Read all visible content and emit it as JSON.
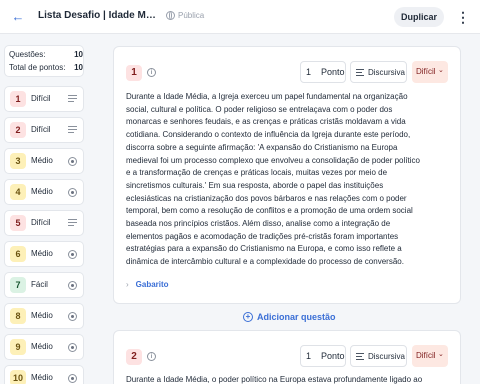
{
  "header": {
    "title": "Lista Desafio | Idade Média:...",
    "visibility": "Pública",
    "duplicate_label": "Duplicar"
  },
  "summary": {
    "questions_label": "Questões:",
    "questions_value": "10",
    "points_label": "Total de pontos:",
    "points_value": "10"
  },
  "questions_list": [
    {
      "num": "1",
      "level": "Difícil",
      "color": "red",
      "type": "essay"
    },
    {
      "num": "2",
      "level": "Difícil",
      "color": "red",
      "type": "essay"
    },
    {
      "num": "3",
      "level": "Médio",
      "color": "yellow",
      "type": "choice"
    },
    {
      "num": "4",
      "level": "Médio",
      "color": "yellow",
      "type": "choice"
    },
    {
      "num": "5",
      "level": "Difícil",
      "color": "red",
      "type": "essay"
    },
    {
      "num": "6",
      "level": "Médio",
      "color": "yellow",
      "type": "choice"
    },
    {
      "num": "7",
      "level": "Fácil",
      "color": "green",
      "type": "choice"
    },
    {
      "num": "8",
      "level": "Médio",
      "color": "yellow",
      "type": "choice"
    },
    {
      "num": "9",
      "level": "Médio",
      "color": "yellow",
      "type": "choice"
    },
    {
      "num": "10",
      "level": "Médio",
      "color": "yellow",
      "type": "choice"
    }
  ],
  "cards": [
    {
      "num": "1",
      "points_value": "1",
      "points_label": "Ponto",
      "type_label": "Discursiva",
      "difficulty": "Difícil",
      "text": "Durante a Idade Média, a Igreja exerceu um papel fundamental na organização social, cultural e política. O poder religioso se entrelaçava com o poder dos monarcas e senhores feudais, e as crenças e práticas cristãs moldavam a vida cotidiana. Considerando o contexto de influência da Igreja durante este período, discorra sobre a seguinte afirmação: 'A expansão do Cristianismo na Europa medieval foi um processo complexo que envolveu a consolidação de poder político e a transformação de crenças e práticas locais, muitas vezes por meio de sincretismos culturais.' Em sua resposta, aborde o papel das instituições eclesiásticas na cristianização dos povos bárbaros e nas relações com o poder temporal, bem como a resolução de conflitos e a promoção de uma ordem social baseada nos princípios cristãos. Além disso, analise como a integração de elementos pagãos e acomodação de tradições pré-cristãs foram importantes estratégias para a expansão do Cristianismo na Europa, e como isso reflete a dinâmica de intercâmbio cultural e a complexidade do processo de conversão.",
      "answer_key_label": "Gabarito"
    },
    {
      "num": "2",
      "points_value": "1",
      "points_label": "Ponto",
      "type_label": "Discursiva",
      "difficulty": "Difícil",
      "text": "Durante a Idade Média, o poder político na Europa estava profundamente ligado ao"
    }
  ],
  "add_question_label": "Adicionar questão"
}
